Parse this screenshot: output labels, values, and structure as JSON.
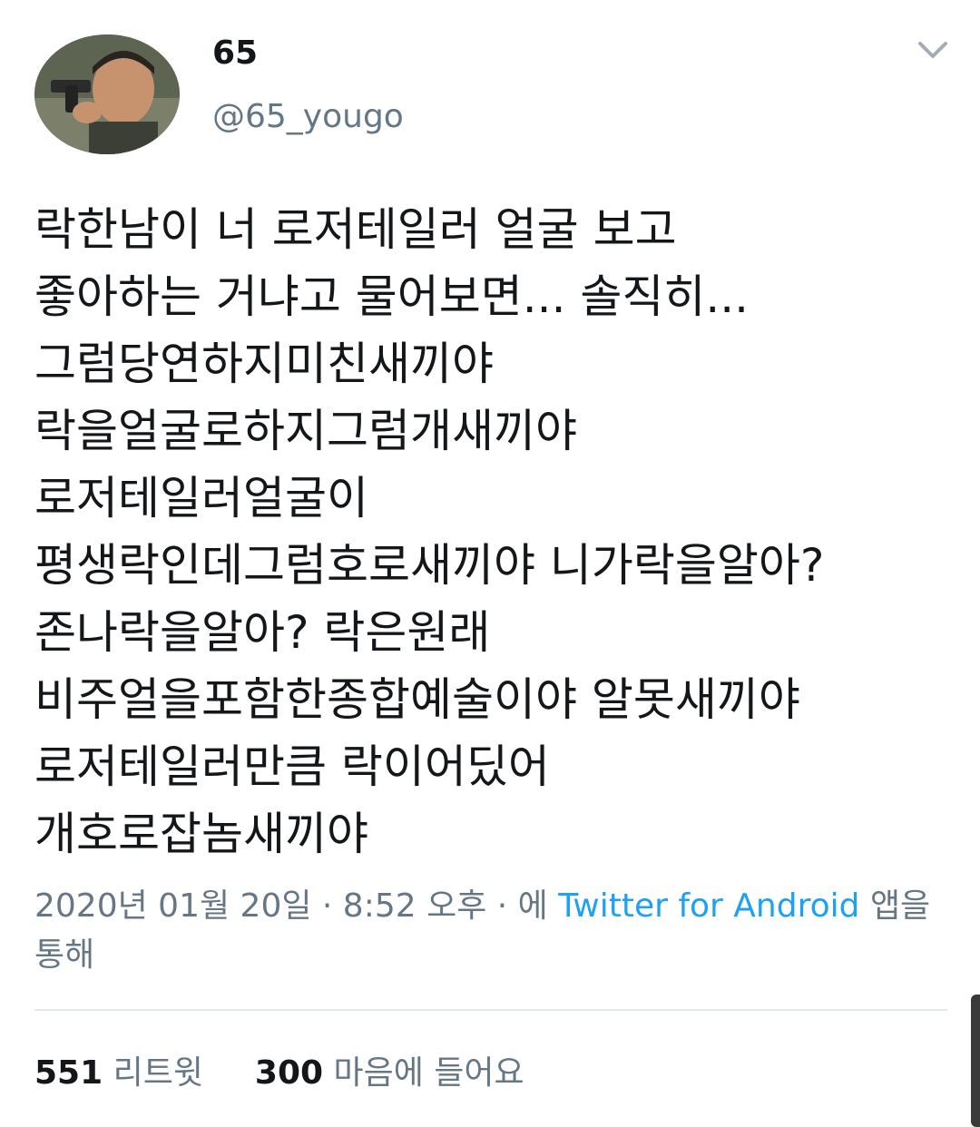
{
  "user": {
    "display_name": "65",
    "handle": "@65_yougo"
  },
  "tweet": {
    "lines": [
      "락한남이 너 로저테일러 얼굴 보고",
      "좋아하는 거냐고 물어보면... 솔직히...",
      "그럼당연하지미친새끼야",
      "락을얼굴로하지그럼개새끼야",
      "로저테일러얼굴이",
      "평생락인데그럼호로새끼야 니가락을알아?",
      "존나락을알아? 락은원래",
      "비주얼을포함한종합예술이야 알못새끼야",
      "로저테일러만큼 락이어딨어",
      "개호로잡놈새끼야"
    ]
  },
  "meta": {
    "timestamp": "2020년 01월 20일 · 8:52 오후 · 에",
    "source": "Twitter for Android",
    "suffix": "앱을 통해"
  },
  "stats": {
    "retweets_count": "551",
    "retweets_label": "리트윗",
    "likes_count": "300",
    "likes_label": "마음에 들어요"
  },
  "colors": {
    "text": "#14171a",
    "secondary": "#657786",
    "link": "#1da1f2",
    "divider": "#e1e8ed"
  },
  "icons": {
    "menu": "chevron-down-icon"
  }
}
